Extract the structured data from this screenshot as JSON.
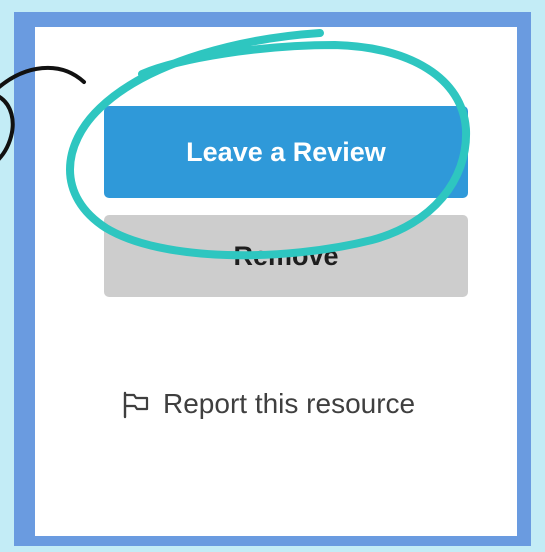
{
  "actions": {
    "leave_review_label": "Leave a Review",
    "remove_label": "Remove",
    "report_label": "Report this resource"
  },
  "icons": {
    "report": "flag-icon"
  },
  "colors": {
    "primary_button": "#2f99d9",
    "secondary_button": "#cdcdcd",
    "frame_border": "#6a9be0",
    "page_background": "#c3ecf6",
    "highlight_circle": "#2ec6c0",
    "annotation_stroke": "#111111"
  }
}
